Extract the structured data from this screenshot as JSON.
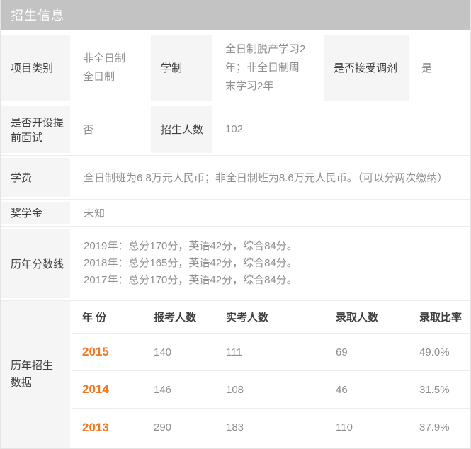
{
  "header": {
    "title": "招生信息"
  },
  "colors": {
    "header_bg": "#c3c3c3",
    "label_cell_bg": "#f5f5f5",
    "accent_orange": "#ee7a23",
    "label_text": "#404040",
    "value_text": "#8f8f8f"
  },
  "fields": {
    "project_type": {
      "label": "项目类别",
      "lines": [
        "非全日制",
        "全日制"
      ]
    },
    "duration": {
      "label": "学制",
      "value": "全日制脱产学习2年；非全日制周末学习2年"
    },
    "transfer": {
      "label": "是否接受调剂",
      "value": "是"
    },
    "pre_interview": {
      "label": "是否开设提前面试",
      "value": "否"
    },
    "enrollment": {
      "label": "招生人数",
      "value": "102"
    },
    "tuition": {
      "label": "学费",
      "value": "全日制班为6.8万元人民币；非全日制班为8.6万元人民币。（可以分两次缴纳）"
    },
    "scholarship": {
      "label": "奖学金",
      "value": "未知"
    },
    "score_lines": {
      "label": "历年分数线",
      "lines": [
        "2019年：总分170分，英语42分，综合84分。",
        "2018年：总分165分，英语42分，综合84分。",
        "2017年：总分170分，英语42分，综合84分。"
      ]
    },
    "history": {
      "label": "历年招生数据"
    }
  },
  "history_table": {
    "columns": [
      "年 份",
      "报考人数",
      "实考人数",
      "录取人数",
      "录取比率"
    ],
    "rows": [
      {
        "year": "2015",
        "applied": "140",
        "attended": "111",
        "admitted": "69",
        "ratio": "49.0%"
      },
      {
        "year": "2014",
        "applied": "146",
        "attended": "108",
        "admitted": "46",
        "ratio": "31.5%"
      },
      {
        "year": "2013",
        "applied": "290",
        "attended": "183",
        "admitted": "110",
        "ratio": "37.9%"
      }
    ]
  }
}
